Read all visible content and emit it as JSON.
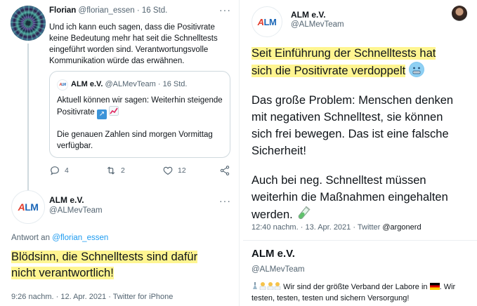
{
  "left": {
    "tweet1": {
      "name": "Florian",
      "handle": "@florian_essen",
      "dot": "·",
      "time": "16 Std.",
      "text": "Und ich kann euch sagen, dass die Positivrate keine Bedeutung mehr hat seit die Schnelltests eingeführt worden sind. Verantwortungsvolle Kommunikation würde das erwähnen.",
      "more": "···",
      "quote": {
        "name": "ALM e.V.",
        "handle": "@ALMevTeam",
        "dot": "·",
        "time": "16 Std.",
        "line1": "Aktuell können wir sagen: Weiterhin steigende",
        "line2": "Positivrate",
        "line3": "Die genauen Zahlen sind morgen Vormittag",
        "line4": "verfügbar."
      },
      "actions": {
        "reply_count": "4",
        "retweet_count": "2",
        "like_count": "12"
      }
    },
    "tweet2": {
      "name": "ALM e.V.",
      "handle": "@ALMevTeam",
      "more": "···",
      "reply_prefix": "Antwort an",
      "reply_to": "@florian_essen",
      "line1": "Blödsinn, die Schnelltests sind dafür",
      "line2": "nicht verantwortlich!",
      "time": "9:26 nachm.",
      "dot": "·",
      "date": "12. Apr. 2021",
      "source": "Twitter for iPhone"
    }
  },
  "right": {
    "tweet3": {
      "name": "ALM e.V.",
      "handle": "@ALMevTeam",
      "hl_line1": "Seit Einführung der Schnelltests hat",
      "hl_line2": "sich die Positivrate verdoppelt",
      "p1_line1": "Das große Problem: Menschen denken",
      "p1_line2": "mit negativen Schnelltest, sie können",
      "p1_line3": "sich frei bewegen. Das ist eine falsche",
      "p1_line4": "Sicherheit!",
      "p2_line1": "Auch bei neg. Schnelltest müssen",
      "p2_line2": "weiterhin die Maßnahmen eingehalten",
      "p2_line3": "werden.",
      "time": "12:40 nachm.",
      "dot": "·",
      "date": "13. Apr. 2021",
      "source": "Twitter",
      "via": "@argonerd"
    },
    "profile": {
      "name": "ALM e.V.",
      "handle": "@ALMevTeam",
      "bio_line1": "Wir sind der größte Verband der Labore in",
      "bio_line1_end": ". Wir",
      "bio_line2": "testen, testen, testen und sichern Versorgung!"
    }
  },
  "logo_text": {
    "a": "A",
    "lm": "LM"
  },
  "colors": {
    "highlight": "#fff591",
    "link": "#1d9bf0",
    "text": "#0f1419",
    "muted": "#536471",
    "logo_red": "#e23b2a",
    "logo_blue": "#1d68b8"
  },
  "icons": [
    "reply-icon",
    "retweet-icon",
    "like-icon",
    "share-icon",
    "chart-up-emoji",
    "arrow-up-right-emoji",
    "cold-face-emoji",
    "test-tube-emoji",
    "germany-flag"
  ]
}
